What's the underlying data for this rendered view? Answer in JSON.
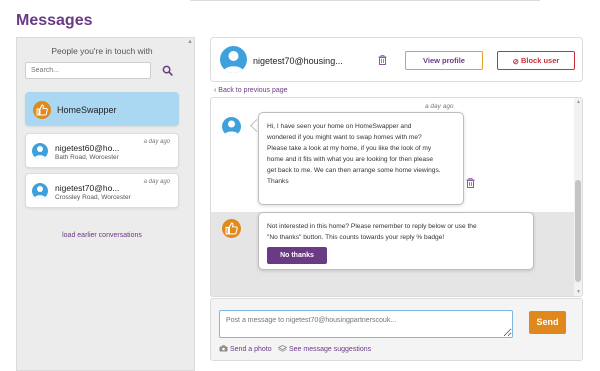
{
  "page": {
    "title": "Messages"
  },
  "sidebar": {
    "heading": "People you're in touch with",
    "search": {
      "placeholder": "Search...",
      "value": ""
    },
    "active_conversation": {
      "name": "HomeSwapper"
    },
    "conversations": [
      {
        "name": "nigetest60@ho...",
        "location": "Bath Road, Worcester",
        "time": "a day ago"
      },
      {
        "name": "nigetest70@ho...",
        "location": "Crossley Road, Worcester",
        "time": "a day ago"
      }
    ],
    "load_earlier": "load earlier conversations"
  },
  "header": {
    "name": "nigetest70@housing...",
    "view_profile_label": "View profile",
    "block_user_label": "Block user"
  },
  "back_link": "Back to previous page",
  "thread": {
    "messages": [
      {
        "time": "a day ago",
        "lines": [
          "Hi, I have seen your home on HomeSwapper and",
          "wondered if you might want to swap homes with me?",
          "Please take a look at my home, if you like the look of my",
          "home and it fits with what you are looking for then please",
          "get back to me. We can then arrange some home viewings.",
          "Thanks"
        ]
      }
    ],
    "system_message": {
      "lines": [
        "Not interested in this home? Please remember to reply below or use the",
        "\"No thanks\" button. This counts towards your reply % badge!"
      ],
      "button_label": "No thanks"
    }
  },
  "compose": {
    "placeholder": "Post a message to nigetest70@housingpartnerscouk...",
    "send_label": "Send",
    "send_photo_label": "Send a photo",
    "suggestions_label": "See message suggestions"
  },
  "colors": {
    "brand_purple": "#6b3a85",
    "accent_orange": "#e0881b",
    "active_blue": "#aad7f2",
    "avatar_blue": "#3fa1dc",
    "block_red": "#c8323c"
  }
}
